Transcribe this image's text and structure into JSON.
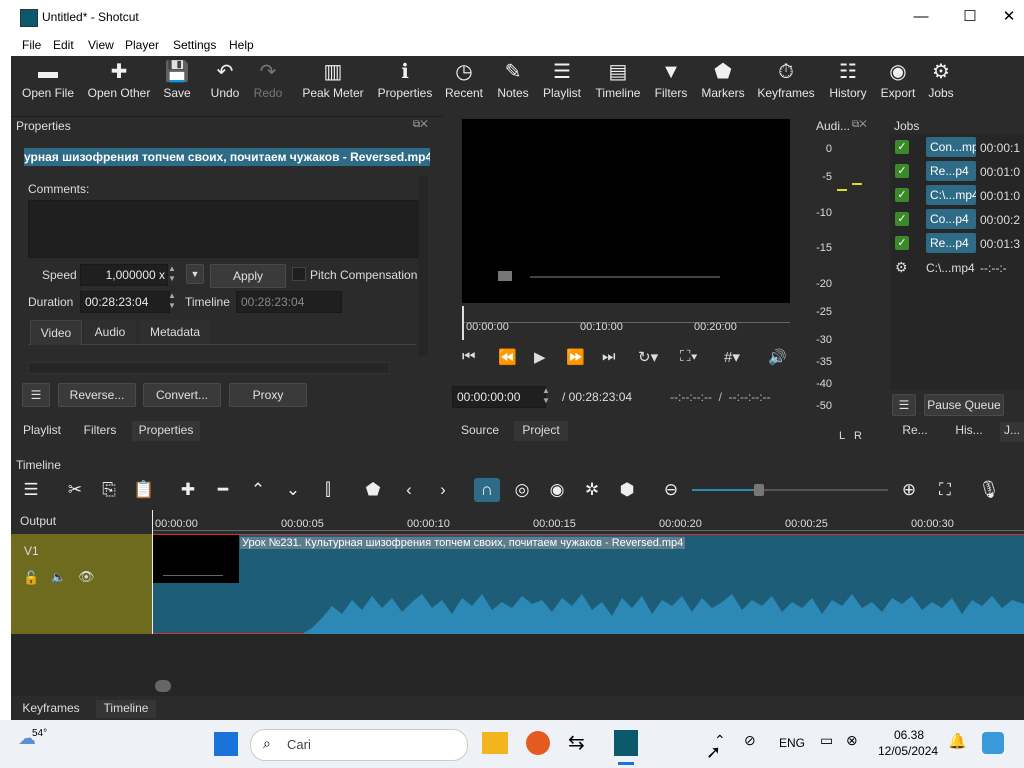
{
  "window": {
    "title": "Untitled* - Shotcut",
    "minimize": "—",
    "maximize": "☐",
    "close": "✕"
  },
  "menu": [
    "File",
    "Edit",
    "View",
    "Player",
    "Settings",
    "Help"
  ],
  "toolbar": [
    {
      "label": "Open File",
      "icon": "open-file-icon",
      "glyph": "▬"
    },
    {
      "label": "Open Other",
      "icon": "open-other-icon",
      "glyph": "✚"
    },
    {
      "label": "Save",
      "icon": "save-icon",
      "glyph": "💾"
    },
    {
      "label": "Undo",
      "icon": "undo-icon",
      "glyph": "↶"
    },
    {
      "label": "Redo",
      "icon": "redo-icon",
      "glyph": "↷"
    },
    {
      "label": "Peak Meter",
      "icon": "peak-meter-icon",
      "glyph": "▥"
    },
    {
      "label": "Properties",
      "icon": "properties-icon",
      "glyph": "ℹ"
    },
    {
      "label": "Recent",
      "icon": "recent-icon",
      "glyph": "◷"
    },
    {
      "label": "Notes",
      "icon": "notes-icon",
      "glyph": "✎"
    },
    {
      "label": "Playlist",
      "icon": "playlist-icon",
      "glyph": "☰"
    },
    {
      "label": "Timeline",
      "icon": "timeline-icon",
      "glyph": "▤"
    },
    {
      "label": "Filters",
      "icon": "filters-icon",
      "glyph": "▼"
    },
    {
      "label": "Markers",
      "icon": "markers-icon",
      "glyph": "⬟"
    },
    {
      "label": "Keyframes",
      "icon": "keyframes-icon",
      "glyph": "⏱"
    },
    {
      "label": "History",
      "icon": "history-icon",
      "glyph": "☷"
    },
    {
      "label": "Export",
      "icon": "export-icon",
      "glyph": "◉"
    },
    {
      "label": "Jobs",
      "icon": "jobs-icon",
      "glyph": "⚙"
    }
  ],
  "properties": {
    "title": "Properties",
    "file_name": "урная шизофрения топчем своих, почитаем чужаков - Reversed.mp4",
    "comments_label": "Comments:",
    "speed_label": "Speed",
    "speed_value": "1,000000 x",
    "apply": "Apply",
    "pitch_compensation": "Pitch Compensation",
    "duration_label": "Duration",
    "duration_value": "00:28:23:04",
    "timeline_label": "Timeline",
    "timeline_value": "00:28:23:04",
    "tabs": [
      "Video",
      "Audio",
      "Metadata"
    ],
    "buttons": [
      "Reverse...",
      "Convert...",
      "Proxy"
    ],
    "bottom_tabs": [
      "Playlist",
      "Filters",
      "Properties"
    ]
  },
  "player": {
    "ruler_ticks": [
      "00:00:00",
      "00:10:00",
      "00:20:00"
    ],
    "current_time": "00:00:00:00",
    "total_time": "/ 00:28:23:04",
    "in_out": "--:--:--:--  /  --:--:--:--",
    "tabs": [
      "Source",
      "Project"
    ]
  },
  "audio_meter": {
    "title": "Audi...",
    "scale": [
      "0",
      "-5",
      "-10",
      "-15",
      "-20",
      "-25",
      "-30",
      "-35",
      "-40",
      "-50"
    ],
    "channels": [
      "L",
      "R"
    ]
  },
  "jobs": {
    "title": "Jobs",
    "items": [
      {
        "name": "Con...mp",
        "time": "00:00:1",
        "done": true
      },
      {
        "name": "Re...p4",
        "time": "00:01:0",
        "done": true
      },
      {
        "name": "C:\\...mp4",
        "time": "00:01:0",
        "done": true
      },
      {
        "name": "Co...p4",
        "time": "00:00:2",
        "done": true
      },
      {
        "name": "Re...p4",
        "time": "00:01:3",
        "done": true
      },
      {
        "name": "C:\\...mp4",
        "time": "--:--:-",
        "done": false
      }
    ],
    "pause_queue": "Pause Queue",
    "tabs": [
      "Re...",
      "His...",
      "J..."
    ]
  },
  "timeline": {
    "title": "Timeline",
    "output_label": "Output",
    "track_name": "V1",
    "ruler_ticks": [
      "00:00:00",
      "00:00:05",
      "00:00:10",
      "00:00:15",
      "00:00:20",
      "00:00:25",
      "00:00:30"
    ],
    "clip_title": "Урок №231. Культурная шизофрения топчем своих, почитаем чужаков - Reversed.mp4",
    "bottom_tabs": [
      "Keyframes",
      "Timeline"
    ]
  },
  "taskbar": {
    "weather_temp": "54°",
    "search_placeholder": "Cari",
    "language": "ENG",
    "time": "06.38",
    "date": "12/05/2024"
  },
  "colors": {
    "accent": "#2e6b86",
    "track_header": "#6e6a1e",
    "track_area": "#1e5d78",
    "panel_bg": "#2b2b2b"
  }
}
